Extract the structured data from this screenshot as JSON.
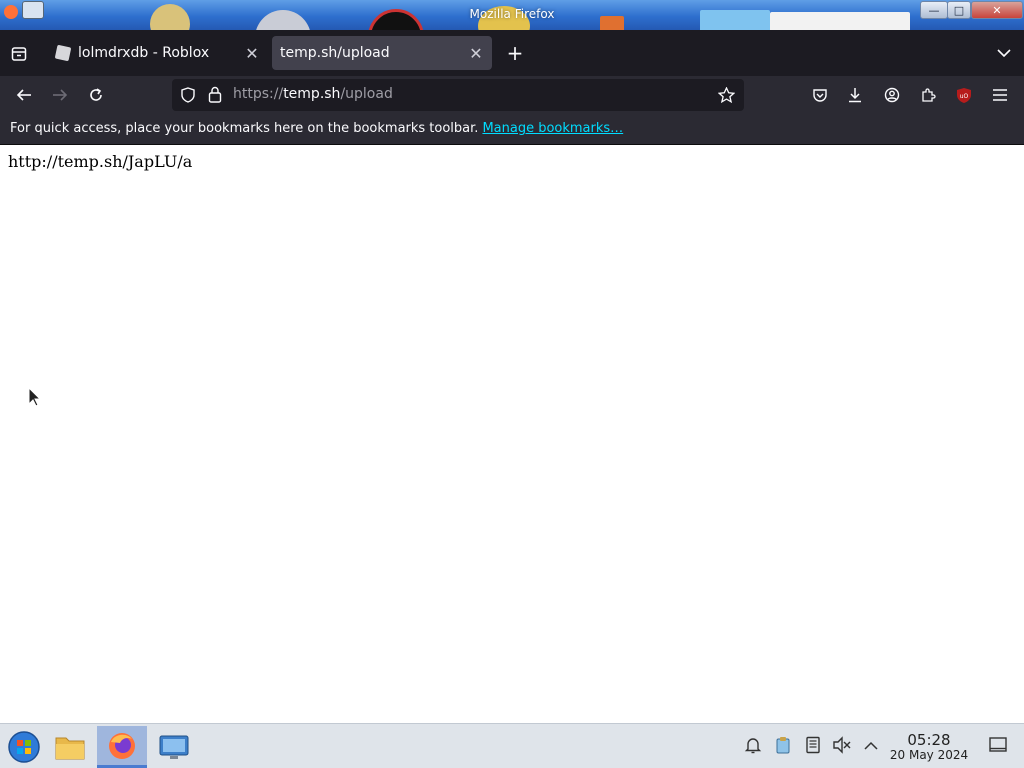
{
  "window": {
    "title": "Mozilla Firefox"
  },
  "tabs": [
    {
      "label": "lolmdrxdb - Roblox",
      "active": false
    },
    {
      "label": "temp.sh/upload",
      "active": true
    }
  ],
  "urlbar": {
    "scheme": "https://",
    "host": "temp.sh",
    "path": "/upload"
  },
  "bookmarks_bar": {
    "message": "For quick access, place your bookmarks here on the bookmarks toolbar.",
    "link": "Manage bookmarks…"
  },
  "page": {
    "text": "http://temp.sh/JapLU/a"
  },
  "taskbar": {
    "time": "05:28",
    "date": "20 May 2024"
  },
  "colors": {
    "accent_link": "#00ddff",
    "toolbar_bg": "#2b2a33",
    "tabstrip_bg": "#1c1b22",
    "ublock_red": "#b71c1c"
  }
}
